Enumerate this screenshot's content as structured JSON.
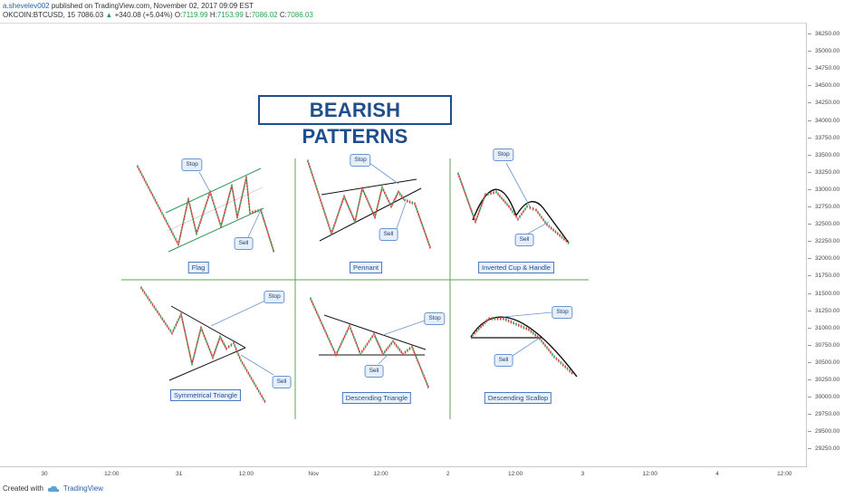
{
  "header": {
    "author": "a.shevelev002",
    "published": "published on TradingView.com, November 02, 2017 09:09 EST",
    "symbol": "OKCOIN:BTCUSD, 15",
    "last_price": "7086.03",
    "change": "+340.08 (+5.04%)",
    "o_label": "O:",
    "o_value": "7119.99",
    "h_label": "H:",
    "h_value": "7153.99",
    "l_label": "L:",
    "l_value": "7086.02",
    "c_label": "C:",
    "c_value": "7086.03"
  },
  "title": "BEARISH PATTERNS",
  "patterns": [
    {
      "name": "Flag",
      "stop": "Stop",
      "sell": "Sell"
    },
    {
      "name": "Pennant",
      "stop": "Stop",
      "sell": "Sell"
    },
    {
      "name": "Inverted Cup & Handle",
      "stop": "Stop",
      "sell": "Sell"
    },
    {
      "name": "Symmetrical Triangle",
      "stop": "Stop",
      "sell": "Sell"
    },
    {
      "name": "Descending Triangle",
      "stop": "Stop",
      "sell": "Sell"
    },
    {
      "name": "Descending Scallop",
      "stop": "Stop",
      "sell": "Sell"
    }
  ],
  "chart_data": {
    "type": "line",
    "price_ticks": [
      "36250.00",
      "35000.00",
      "34750.00",
      "34500.00",
      "34250.00",
      "34000.00",
      "33750.00",
      "33500.00",
      "33250.00",
      "33000.00",
      "32750.00",
      "32500.00",
      "32250.00",
      "32000.00",
      "31750.00",
      "31500.00",
      "31250.00",
      "31000.00",
      "30750.00",
      "30500.00",
      "30250.00",
      "30000.00",
      "29750.00",
      "29500.00",
      "29250.00"
    ],
    "time_ticks": [
      "30",
      "12:00",
      "31",
      "12:00",
      "Nov",
      "12:00",
      "2",
      "12:00",
      "3",
      "12:00",
      "4",
      "12:00"
    ],
    "grid": false
  },
  "footer": {
    "created_with": "Created with",
    "brand": "TradingView"
  },
  "colors": {
    "label_blue": "#1f4e8c",
    "channel_green": "#2e9a57",
    "divider_green": "#5aa84a",
    "candle_up": "#2aa64a",
    "candle_down": "#d9423c"
  }
}
